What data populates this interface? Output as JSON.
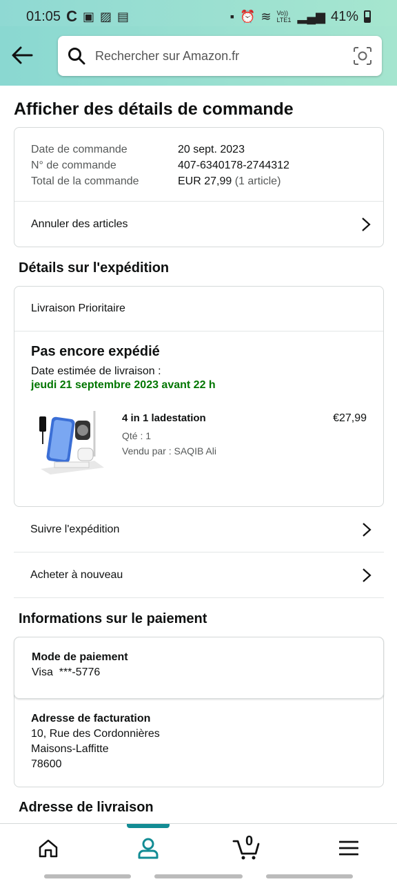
{
  "status_bar": {
    "time": "01:05",
    "carrier_icons": [
      "c-icon",
      "sim-icon",
      "image-icon",
      "calendar-icon"
    ],
    "volte": "Vo)) LTE1",
    "battery_text": "41%"
  },
  "search": {
    "placeholder": "Rechercher sur Amazon.fr"
  },
  "page": {
    "title": "Afficher des détails de commande"
  },
  "order_summary": {
    "rows": [
      {
        "label": "Date de commande",
        "value": "20 sept. 2023"
      },
      {
        "label": "N° de commande",
        "value": "407-6340178-2744312"
      },
      {
        "label": "Total de la commande",
        "value": "EUR 27,99",
        "extra": "(1 article)"
      }
    ],
    "cancel_label": "Annuler des articles"
  },
  "shipping": {
    "section_title": "Détails sur l'expédition",
    "method": "Livraison Prioritaire",
    "status": "Pas encore expédié",
    "est_label": "Date estimée de livraison :",
    "est_date": "jeudi 21 septembre 2023 avant 22 h",
    "item": {
      "name": "4 in 1 ladestation",
      "qty": "Qté : 1",
      "seller": "Vendu par : SAQIB Ali",
      "price": "€27,99"
    },
    "track_label": "Suivre l'expédition",
    "buy_again_label": "Acheter à nouveau"
  },
  "payment": {
    "section_title": "Informations sur le paiement",
    "method_label": "Mode de paiement",
    "method_value": "Visa  ***-5776",
    "billing_label": "Adresse de facturation",
    "billing_line1": "10, Rue des Cordonnières",
    "billing_line2": "Maisons-Laffitte",
    "billing_line3": "78600"
  },
  "delivery": {
    "section_title": "Adresse de livraison"
  },
  "bottom_nav": {
    "cart_count": "0",
    "active_tab": "account",
    "accent_color": "#128c94"
  }
}
